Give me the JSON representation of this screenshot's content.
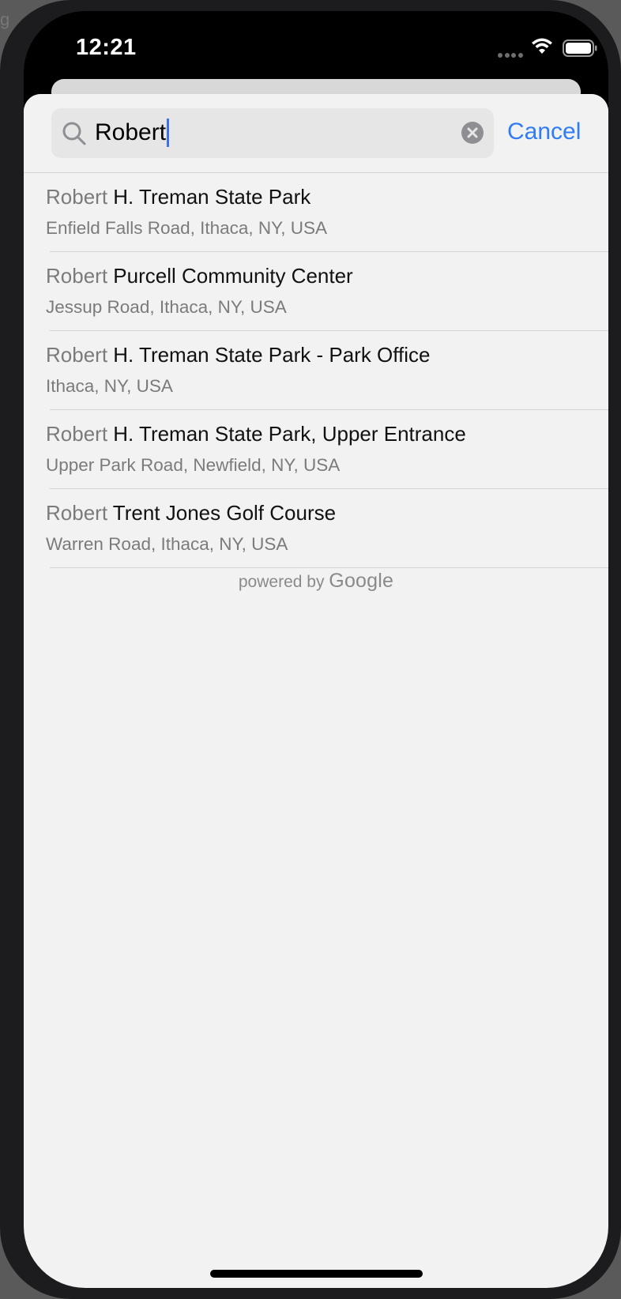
{
  "status_bar": {
    "time": "12:21",
    "icons": [
      "cellular-dots-icon",
      "wifi-icon",
      "battery-icon"
    ]
  },
  "background_fragment": "g",
  "search": {
    "query": "Robert",
    "cancel_label": "Cancel",
    "accent_color": "#2f7cf6"
  },
  "results": [
    {
      "match": "Robert",
      "rest": " H. Treman State Park",
      "subtitle": "Enfield Falls Road, Ithaca, NY, USA"
    },
    {
      "match": "Robert",
      "rest": " Purcell Community Center",
      "subtitle": "Jessup Road, Ithaca, NY, USA"
    },
    {
      "match": "Robert",
      "rest": " H. Treman State Park - Park Office",
      "subtitle": "Ithaca, NY, USA"
    },
    {
      "match": "Robert",
      "rest": " H. Treman State Park, Upper Entrance",
      "subtitle": "Upper Park Road, Newfield, NY, USA"
    },
    {
      "match": "Robert",
      "rest": " Trent Jones Golf Course",
      "subtitle": "Warren Road, Ithaca, NY, USA"
    }
  ],
  "attribution": {
    "prefix": "powered by",
    "brand": "Google"
  }
}
